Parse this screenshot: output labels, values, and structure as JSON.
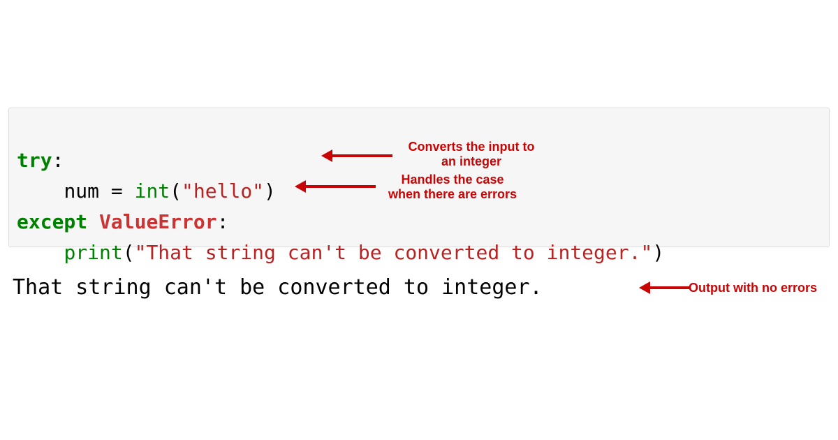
{
  "code": {
    "line1": {
      "try_kw": "try",
      "colon": ":"
    },
    "line2": {
      "indent": "    ",
      "var": "num ",
      "eq": "= ",
      "fn": "int",
      "lp": "(",
      "str": "\"hello\"",
      "rp": ")"
    },
    "line3": {
      "except_kw": "except",
      "sp": " ",
      "err": "ValueError",
      "colon": ":"
    },
    "line4": {
      "indent": "    ",
      "fn": "print",
      "lp": "(",
      "str": "\"That string can't be converted to integer.\"",
      "rp": ")"
    }
  },
  "output": "That string can't be converted to integer.",
  "annotations": {
    "convert": "Converts the input to\nan integer",
    "handles": "Handles the case\nwhen there are errors",
    "out": "Output with no errors"
  }
}
